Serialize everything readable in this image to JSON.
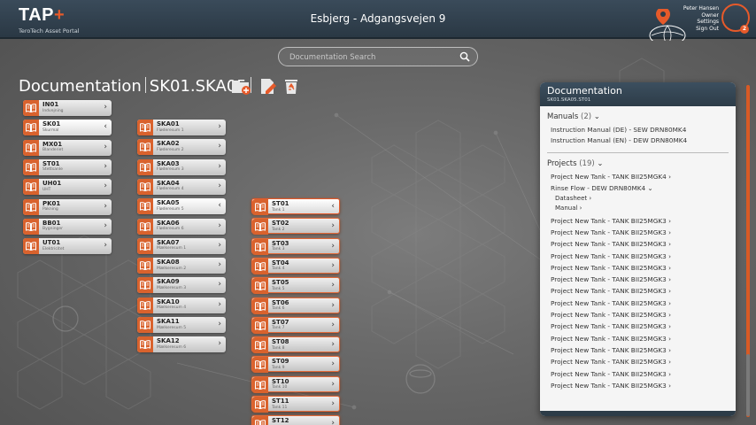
{
  "header": {
    "logo_main": "TAP",
    "logo_plus": "+",
    "logo_sub": "TeroTech Asset Portal",
    "site_title": "Esbjerg - Adgangsvejen 9",
    "user_name": "Peter Hansen",
    "user_role": "Owner",
    "settings_label": "Settings",
    "signout_label": "Sign Out",
    "notification_count": "2",
    "accent_color": "#e65a2a"
  },
  "search": {
    "placeholder": "Documentation Search"
  },
  "breadcrumb": {
    "title": "Documentation",
    "path": "SK01.SKA05"
  },
  "tools": [
    "folder-add-icon",
    "edit-document-icon",
    "recycle-bin-icon"
  ],
  "column1": [
    {
      "code": "IN01",
      "sub": "Indvejning"
    },
    {
      "code": "SK01",
      "sub": "Skurmal",
      "active": true
    },
    {
      "code": "MX01",
      "sub": "Blanderiet"
    },
    {
      "code": "ST01",
      "sub": "Stettsanle"
    },
    {
      "code": "UH01",
      "sub": "UHT"
    },
    {
      "code": "PK01",
      "sub": "Pakning"
    },
    {
      "code": "BB01",
      "sub": "Bygninger"
    },
    {
      "code": "UT01",
      "sub": "Elektricitet"
    }
  ],
  "column2": [
    {
      "code": "SKA01",
      "sub": "Fløderesum 1"
    },
    {
      "code": "SKA02",
      "sub": "Fløderesum 2"
    },
    {
      "code": "SKA03",
      "sub": "Fløderesum 3"
    },
    {
      "code": "SKA04",
      "sub": "Fløderesum 4"
    },
    {
      "code": "SKA05",
      "sub": "Fløderesum 5",
      "active": true
    },
    {
      "code": "SKA06",
      "sub": "Fløderesum 6"
    },
    {
      "code": "SKA07",
      "sub": "Mælkeresum 1"
    },
    {
      "code": "SKA08",
      "sub": "Mælkeresum 2"
    },
    {
      "code": "SKA09",
      "sub": "Mælkeresum 3"
    },
    {
      "code": "SKA10",
      "sub": "Mælkeresum 4"
    },
    {
      "code": "SKA11",
      "sub": "Mælkeresum 5"
    },
    {
      "code": "SKA12",
      "sub": "Mælkeresum 6"
    }
  ],
  "column3": [
    {
      "code": "ST01",
      "sub": "Tank 1",
      "active": true
    },
    {
      "code": "ST02",
      "sub": "Tank 2"
    },
    {
      "code": "ST03",
      "sub": "Tank 3"
    },
    {
      "code": "ST04",
      "sub": "Tank 4"
    },
    {
      "code": "ST05",
      "sub": "Tank 5"
    },
    {
      "code": "ST06",
      "sub": "Tank 6"
    },
    {
      "code": "ST07",
      "sub": "Tank 7"
    },
    {
      "code": "ST08",
      "sub": "Tank 8"
    },
    {
      "code": "ST09",
      "sub": "Tank 9"
    },
    {
      "code": "ST10",
      "sub": "Tank 10"
    },
    {
      "code": "ST11",
      "sub": "Tank 11"
    },
    {
      "code": "ST12",
      "sub": ""
    }
  ],
  "panel": {
    "title": "Documentation",
    "subtitle": "SK01.SKA05.ST01",
    "manuals_label": "Manuals",
    "manuals_count": "(2)",
    "manuals": [
      "Instruction Manual (DE) - SEW DRN80MK4",
      "Instruction Manual (EN) - DEW DRN80MK4"
    ],
    "projects_label": "Projects",
    "projects_count": "(19)",
    "projects": [
      {
        "label": "Project New Tank - TANK BII25MGK4"
      },
      {
        "label": "Rinse Flow - DEW DRN80MK4",
        "expanded": true,
        "children": [
          "Datasheet",
          "Manual"
        ]
      },
      {
        "label": "Project New Tank - TANK BII25MGK3"
      },
      {
        "label": "Project New Tank - TANK BII25MGK3"
      },
      {
        "label": "Project New Tank - TANK BII25MGK3"
      },
      {
        "label": "Project New Tank - TANK BII25MGK3"
      },
      {
        "label": "Project New Tank - TANK BII25MGK3"
      },
      {
        "label": "Project New Tank - TANK BII25MGK3"
      },
      {
        "label": "Project New Tank - TANK BII25MGK3"
      },
      {
        "label": "Project New Tank - TANK BII25MGK3"
      },
      {
        "label": "Project New Tank - TANK BII25MGK3"
      },
      {
        "label": "Project New Tank - TANK BII25MGK3"
      },
      {
        "label": "Project New Tank - TANK BII25MGK3"
      },
      {
        "label": "Project New Tank - TANK BII25MGK3"
      },
      {
        "label": "Project New Tank - TANK BII25MGK3"
      },
      {
        "label": "Project New Tank - TANK BII25MGK3"
      },
      {
        "label": "Project New Tank - TANK BII25MGK3"
      }
    ]
  }
}
